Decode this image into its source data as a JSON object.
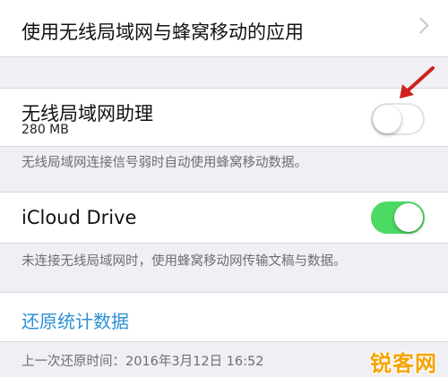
{
  "wlan_cellular_apps": {
    "label": "使用无线局域网与蜂窝移动的应用"
  },
  "wifi_assist": {
    "label": "无线局域网助理",
    "size": "280 MB",
    "enabled": false,
    "footer": "无线局域网连接信号弱时自动使用蜂窝移动数据。"
  },
  "icloud_drive": {
    "label": "iCloud Drive",
    "enabled": true,
    "footer": "未连接无线局域网时，使用蜂窝移动网传输文稿与数据。"
  },
  "reset_stats": {
    "label": "还原统计数据",
    "last_reset": "上一次还原时间：2016年3月12日 16:52"
  },
  "watermark": {
    "text": "锐客网"
  },
  "colors": {
    "switch_on": "#4cd964",
    "link": "#2c8fd6",
    "annotation_arrow": "#d0211c",
    "watermark": "#f5a400"
  },
  "icons": {
    "chevron": "chevron-right-icon",
    "annotation": "red-arrow-icon"
  }
}
